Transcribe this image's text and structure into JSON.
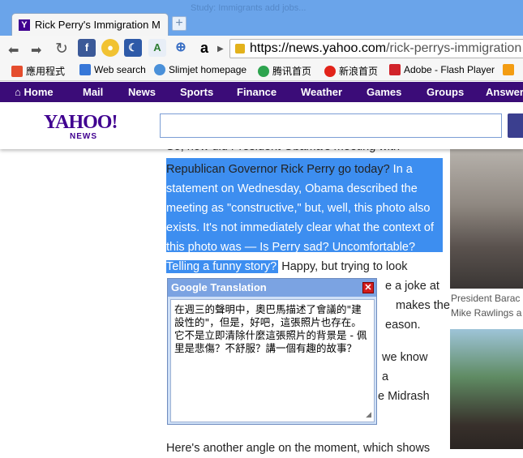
{
  "browser": {
    "tab_title": "Rick Perry's Immigration M",
    "ghost_tab": "Study: Immigrants add jobs...",
    "url_domain": "https://news.yahoo.com",
    "url_path": "/rick-perrys-immigration",
    "new_tab": "+"
  },
  "bookmarks": [
    {
      "label": "應用程式",
      "icon_color": "#e54d2e"
    },
    {
      "label": "Web search",
      "icon_color": "#3777d8"
    },
    {
      "label": "Slimjet homepage",
      "icon_color": "#4a90d9"
    },
    {
      "label": "腾讯首页",
      "icon_color": "#2ea44f"
    },
    {
      "label": "新浪首页",
      "icon_color": "#e2231a"
    },
    {
      "label": "Adobe - Flash Player",
      "icon_color": "#d1232a"
    }
  ],
  "yahoo_nav": [
    "Home",
    "Mail",
    "News",
    "Sports",
    "Finance",
    "Weather",
    "Games",
    "Groups",
    "Answers"
  ],
  "yahoo": {
    "logo": "YAHOO!",
    "sub": "NEWS"
  },
  "article": {
    "line0": "So, how did President Obama's meeting with",
    "line1_plain": "Republican Governor Rick Perry go today?",
    "line1_hl": " In a",
    "hl2": "statement on Wednesday, Obama described the",
    "hl3": "meeting as \"constructive,\" but, well, this photo also",
    "hl4": "exists. It's not immediately clear what the context of",
    "hl5": "this photo was — Is Perry sad? Uncomfortable?",
    "hl6": "Telling a funny story?",
    "line6_plain": " Happy, but trying to look",
    "frag7": "e a joke at",
    "frag8": "makes the",
    "frag9": "eason.",
    "frag10": "we know",
    "frag11": "a",
    "frag12": "e Midrash",
    "last": "Here's another angle on the moment, which shows"
  },
  "right": {
    "caption1": "President Barac",
    "caption2": "Mike Rawlings a"
  },
  "translation": {
    "title": "Google Translation",
    "close": "✕",
    "text": "在週三的聲明中，奧巴馬描述了會議的\"建設性的\"，但是，好吧，這張照片也存在。它不是立即清除什麼這張照片的背景是 - 佩里是悲傷？不舒服？講一個有趣的故事？"
  }
}
